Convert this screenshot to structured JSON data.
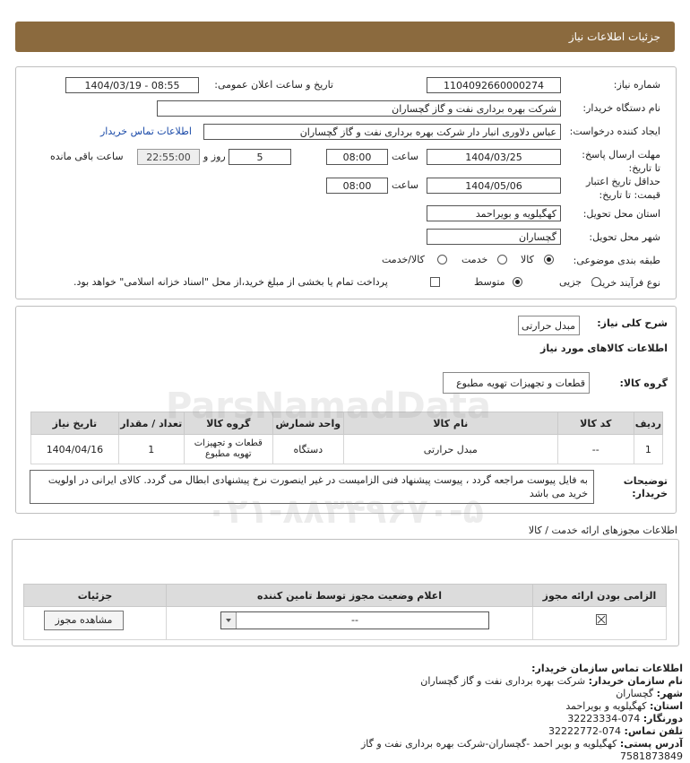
{
  "header": {
    "title": "جزئیات اطلاعات نیاز"
  },
  "form": {
    "need_no_label": "شماره نیاز:",
    "need_no": "1104092660000274",
    "announce_label": "تاریخ و ساعت اعلان عمومی:",
    "announce_value": "1404/03/19 - 08:55",
    "buyer_label": "نام دستگاه خریدار:",
    "buyer_value": "شرکت بهره برداری نفت و گاز گچساران",
    "creator_label": "ایجاد کننده درخواست:",
    "creator_value": "عباس دلاوری انبار دار شرکت بهره برداری نفت و گاز گچساران",
    "contact_link": "اطلاعات تماس خریدار",
    "deadline_label": "مهلت ارسال پاسخ: تا تاریخ:",
    "deadline_date": "1404/03/25",
    "time_label": "ساعت",
    "deadline_time": "08:00",
    "days_value": "5",
    "days_label": "روز و",
    "remaining_time": "22:55:00",
    "remaining_label": "ساعت باقی مانده",
    "validity_label": "حداقل تاریخ اعتبار قیمت: تا تاریخ:",
    "validity_date": "1404/05/06",
    "validity_time": "08:00",
    "province_label": "استان محل تحویل:",
    "province_value": "کهگیلویه و بویراحمد",
    "city_label": "شهر محل تحویل:",
    "city_value": "گچساران",
    "category_label": "طبقه بندی موضوعی:",
    "category_options": [
      "کالا",
      "خدمت",
      "کالا/خدمت"
    ],
    "process_label": "نوع فرآیند خرید :",
    "process_options": [
      "جزیی",
      "متوسط"
    ],
    "payment_note": "پرداخت تمام یا بخشی از مبلغ خرید،از محل \"اسناد خزانه اسلامی\" خواهد بود."
  },
  "summary": {
    "desc_label": "شرح کلی نیاز:",
    "desc_value": "مبدل حرارتی",
    "goods_info_label": "اطلاعات کالاهای مورد نیاز",
    "group_label": "گروه کالا:",
    "group_value": "قطعات و تجهیزات تهویه مطبوع",
    "table_headers": [
      "ردیف",
      "کد کالا",
      "نام کالا",
      "واحد شمارش",
      "گروه کالا",
      "تعداد / مقدار",
      "تاریخ نیاز"
    ],
    "rows": [
      {
        "row": "1",
        "code": "--",
        "name": "مبدل حرارتی",
        "unit": "دستگاه",
        "group": "قطعات و تجهیزات تهویه مطبوع",
        "qty": "1",
        "date": "1404/04/16"
      }
    ],
    "buyer_notes_label": "توضیحات خریدار:",
    "buyer_notes": "به فایل پیوست مراجعه گردد ، پیوست پیشنهاد فنی الزامیست در غیر اینصورت نرخ پیشنهادی ابطال می گردد. کالای ایرانی در اولویت خرید می باشد"
  },
  "permits": {
    "section_label": "اطلاعات مجوزهای ارائه خدمت / کالا",
    "headers": [
      "الزامی بودن ارائه مجوز",
      "اعلام وضعیت مجوز توسط تامین کننده",
      "جزئیات"
    ],
    "status_value": "--",
    "view_button": "مشاهده مجوز"
  },
  "contact": {
    "title": "اطلاعات تماس سازمان خریدار:",
    "org_label": "نام سازمان خریدار:",
    "org_value": "شرکت بهره برداری نفت و گاز گچساران",
    "city_label": "شهر:",
    "city_value": "گچساران",
    "province_label": "استان:",
    "province_value": "کهگیلویه و بویراحمد",
    "fax_label": "دورنگار:",
    "fax_value": "074-32223334",
    "phone_label": "تلفن تماس:",
    "phone_value": "074-32222772",
    "address_label": "آدرس پستی:",
    "address_value": "کهگیلویه و بویر احمد -گچساران-شرکت بهره برداری نفت و گاز",
    "postal_value": "7581873849"
  },
  "watermark": {
    "brand": "ParsNamadData",
    "phone": "۰۲۱-۸۸۳۴۹۶۷۰-۵"
  }
}
